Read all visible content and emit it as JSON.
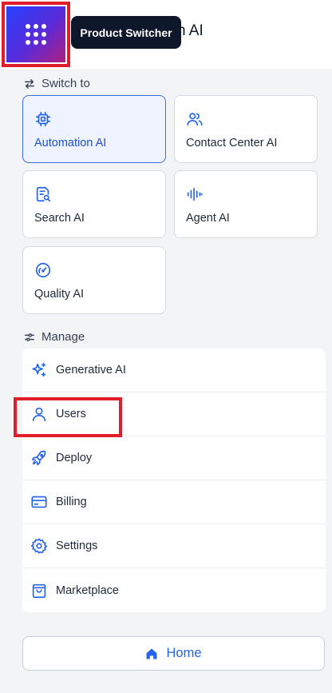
{
  "header": {
    "title": "n AI",
    "tooltip": "Product Switcher"
  },
  "switch_section": {
    "label": "Switch to",
    "products": [
      {
        "label": "Automation AI",
        "icon": "chip-icon",
        "active": true
      },
      {
        "label": "Contact Center AI",
        "icon": "users-icon",
        "active": false
      },
      {
        "label": "Search AI",
        "icon": "document-search-icon",
        "active": false
      },
      {
        "label": "Agent AI",
        "icon": "waveform-icon",
        "active": false
      },
      {
        "label": "Quality AI",
        "icon": "gauge-icon",
        "active": false
      }
    ]
  },
  "manage_section": {
    "label": "Manage",
    "items": [
      {
        "label": "Generative AI",
        "icon": "sparkles-icon"
      },
      {
        "label": "Users",
        "icon": "user-icon"
      },
      {
        "label": "Deploy",
        "icon": "rocket-icon"
      },
      {
        "label": "Billing",
        "icon": "credit-card-icon"
      },
      {
        "label": "Settings",
        "icon": "gear-icon"
      },
      {
        "label": "Marketplace",
        "icon": "shopping-bag-icon"
      }
    ]
  },
  "home_button": {
    "label": "Home",
    "icon": "home-icon"
  },
  "colors": {
    "accent": "#2563eb",
    "active_card_bg": "#eef3ff",
    "highlight": "#e11d2a"
  }
}
